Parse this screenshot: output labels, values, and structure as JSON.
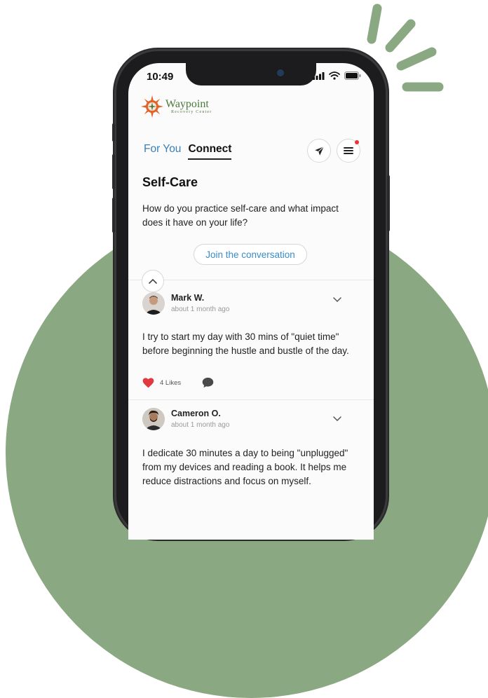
{
  "status_bar": {
    "time": "10:49"
  },
  "brand": {
    "name": "Waypoint",
    "subtitle": "Recovery Center"
  },
  "tabs": [
    {
      "label": "For You"
    },
    {
      "label": "Connect"
    }
  ],
  "topic": {
    "title": "Self-Care",
    "question": "How do you practice self-care and what impact does it have on your life?",
    "join_label": "Join the conversation"
  },
  "posts": [
    {
      "author": "Mark W.",
      "time": "about 1 month ago",
      "text": "I try to start my day with 30 mins of \"quiet time\" before beginning the hustle and bustle of the day.",
      "likes": "4 Likes"
    },
    {
      "author": "Cameron O.",
      "time": "about 1 month ago",
      "text": "I dedicate 30 minutes a day to being \"unplugged\" from my devices and reading a book. It helps me reduce distractions and focus on myself."
    }
  ],
  "colors": {
    "accent_green": "#8aa881",
    "link_blue": "#3a8dc7",
    "brand_orange": "#e0642a",
    "like_red": "#e0393e"
  }
}
